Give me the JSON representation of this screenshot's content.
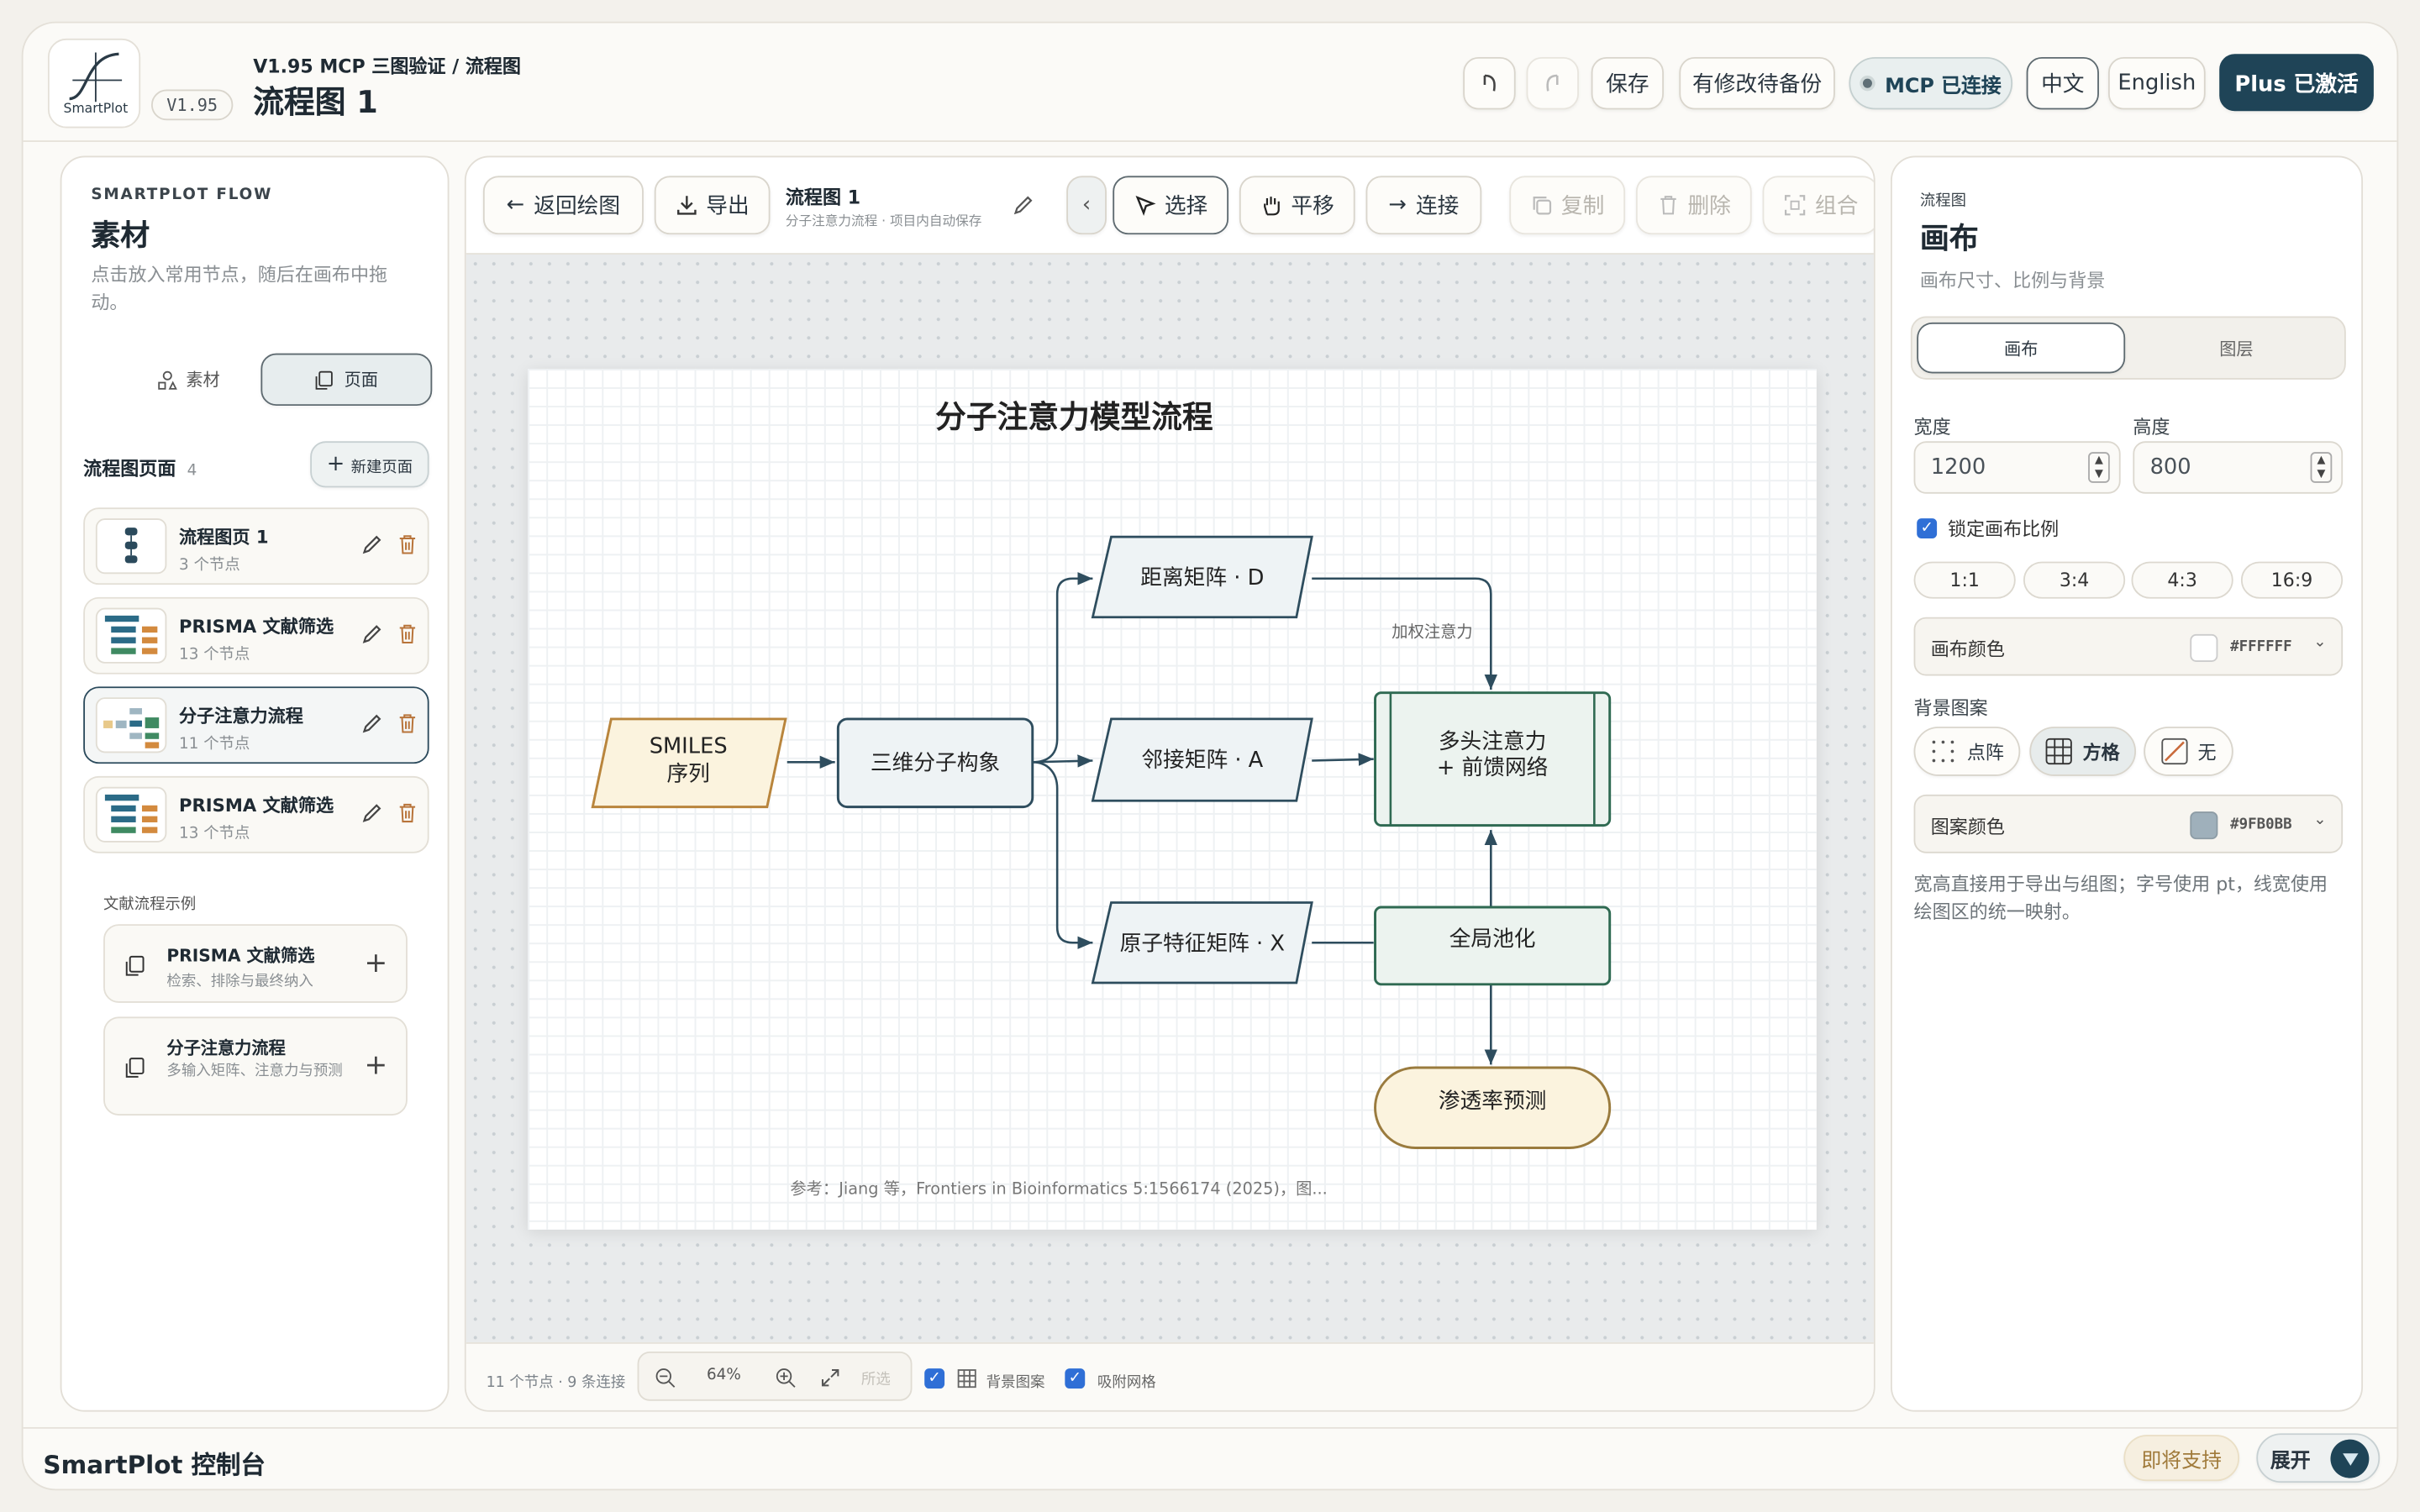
{
  "app": {
    "logo_text": "SmartPlot",
    "version_badge": "V1.95",
    "breadcrumb": "V1.95 MCP 三图验证 / 流程图",
    "title": "流程图 1"
  },
  "header": {
    "save": "保存",
    "backup": "有修改待备份",
    "mcp": "MCP 已连接",
    "lang_zh": "中文",
    "lang_en": "English",
    "plus": "Plus 已激活"
  },
  "left": {
    "kicker": "SMARTPLOT FLOW",
    "title": "素材",
    "desc": "点击放入常用节点，随后在画布中拖动。",
    "tab_assets": "素材",
    "tab_pages": "页面",
    "pages_label": "流程图页面",
    "pages_count": "4",
    "new_page": "新建页面",
    "pages": [
      {
        "name": "流程图页 1",
        "meta": "3 个节点"
      },
      {
        "name": "PRISMA 文献筛选",
        "meta": "13 个节点"
      },
      {
        "name": "分子注意力流程",
        "meta": "11 个节点"
      },
      {
        "name": "PRISMA 文献筛选",
        "meta": "13 个节点"
      }
    ],
    "examples_label": "文献流程示例",
    "examples": [
      {
        "name": "PRISMA 文献筛选",
        "desc": "检索、排除与最终纳入"
      },
      {
        "name": "分子注意力流程",
        "desc": "多输入矩阵、注意力与预测"
      }
    ]
  },
  "toolbar": {
    "back": "返回绘图",
    "export": "导出",
    "doc_title": "流程图 1",
    "doc_sub": "分子注意力流程 · 项目内自动保存",
    "select": "选择",
    "pan": "平移",
    "connect": "连接",
    "copy": "复制",
    "delete": "删除",
    "group": "组合"
  },
  "diagram": {
    "title": "分子注意力模型流程",
    "n_smiles": "SMILES\n序列",
    "n_conf": "三维分子构象",
    "n_dist": "距离矩阵 · D",
    "n_adj": "邻接矩阵 · A",
    "n_feat": "原子特征矩阵 · X",
    "n_attn": "多头注意力\n+ 前馈网络",
    "n_pool": "全局池化",
    "n_pred": "渗透率预测",
    "edge_label": "加权注意力",
    "reference": "参考：Jiang 等，Frontiers in Bioinformatics 5:1566174 (2025)，图..."
  },
  "status": {
    "stats": "11 个节点 · 9 条连接",
    "zoom": "64%",
    "fit": "所选",
    "bg_pattern": "背景图案",
    "snap": "吸附网格"
  },
  "right": {
    "kicker": "流程图",
    "title": "画布",
    "desc": "画布尺寸、比例与背景",
    "tab_canvas": "画布",
    "tab_layers": "图层",
    "width_label": "宽度",
    "width": "1200",
    "height_label": "高度",
    "height": "800",
    "lock_ratio": "锁定画布比例",
    "ratios": [
      "1:1",
      "3:4",
      "4:3",
      "16:9"
    ],
    "canvas_color_label": "画布颜色",
    "canvas_color": "#FFFFFF",
    "pattern_label": "背景图案",
    "pattern_dots": "点阵",
    "pattern_grid": "方格",
    "pattern_none": "无",
    "pattern_color_label": "图案颜色",
    "pattern_color": "#9FB0BB",
    "note": "宽高直接用于导出与组图；字号使用 pt，线宽使用绘图区的统一映射。"
  },
  "footer": {
    "title": "SmartPlot 控制台",
    "soon": "即将支持",
    "expand": "展开"
  },
  "colors": {
    "accent": "#1f4457",
    "node_fill": "#eef3f5",
    "node_stroke": "#2e4d5e",
    "green_fill": "#ecf3ef",
    "green_stroke": "#2f6a52",
    "input_fill": "#fbf3de",
    "input_stroke": "#b9853c"
  }
}
